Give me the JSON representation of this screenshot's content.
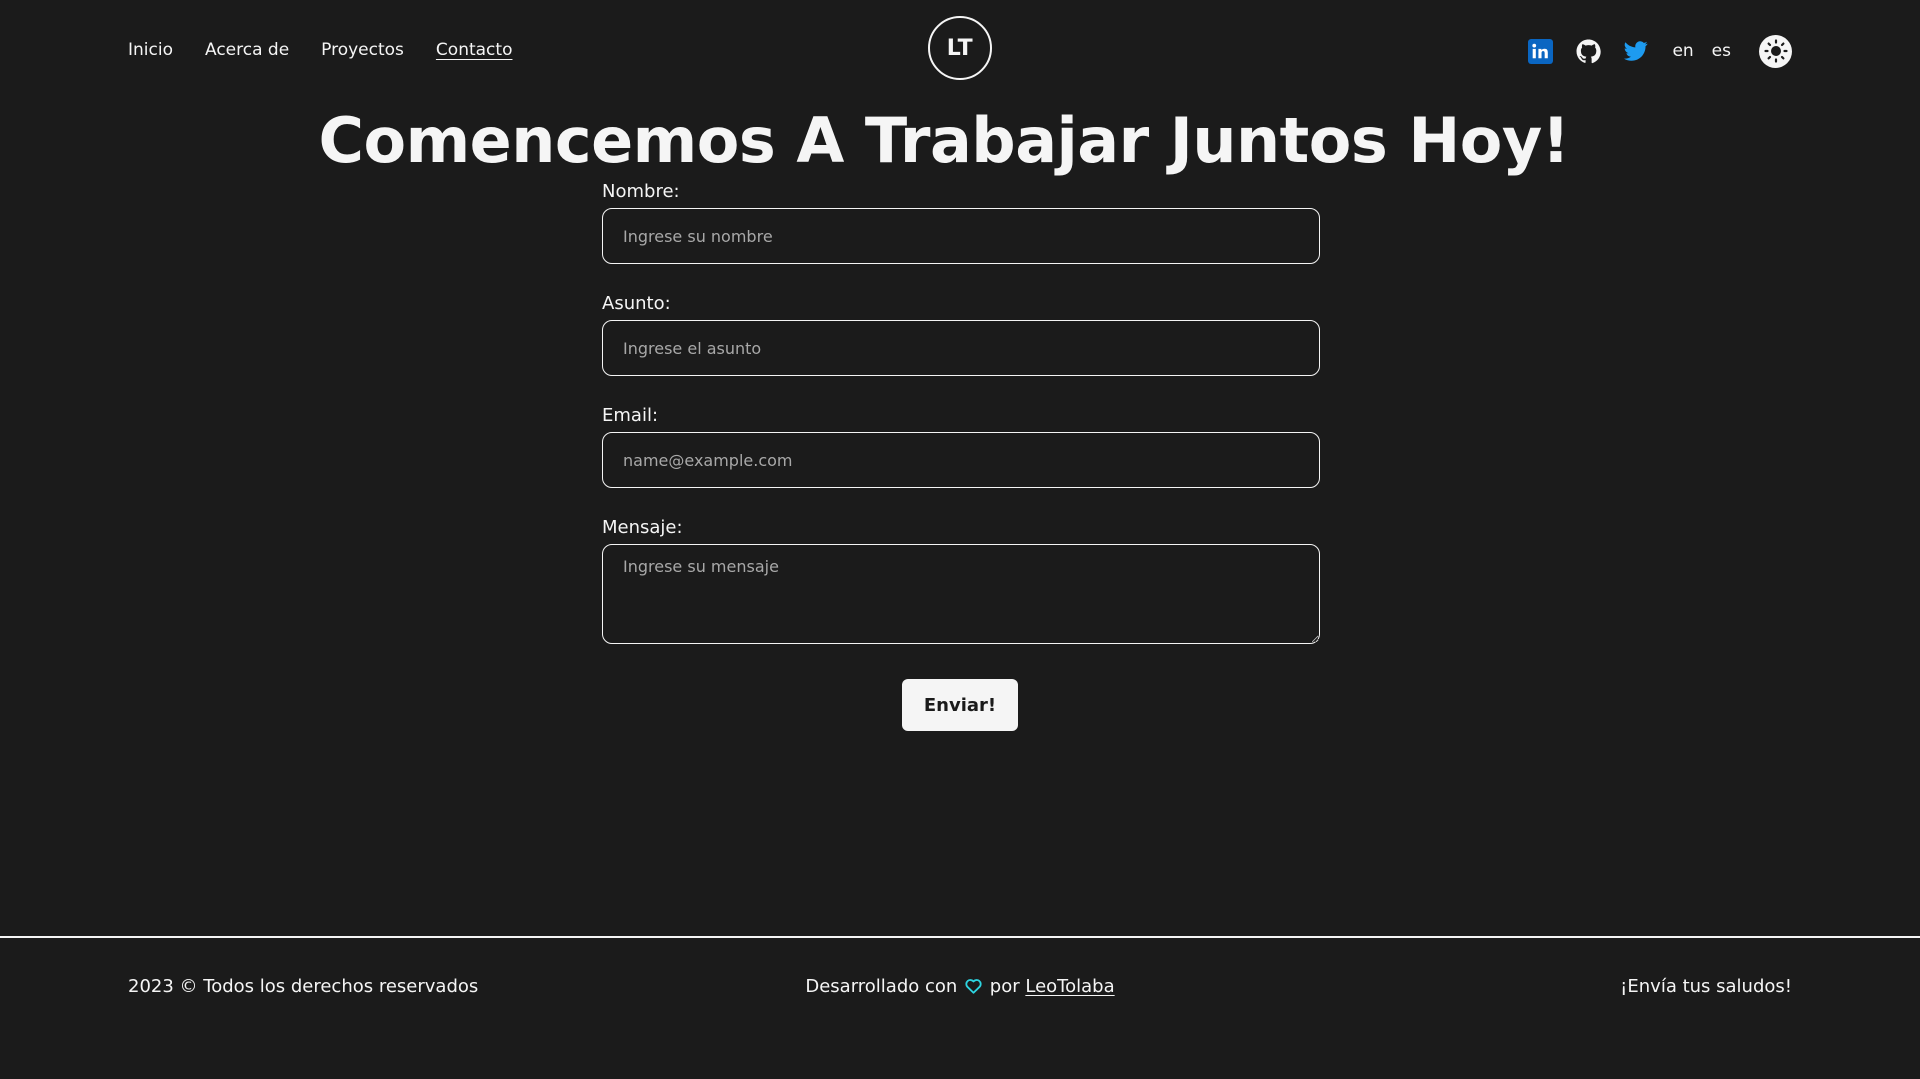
{
  "nav": {
    "items": [
      {
        "label": "Inicio"
      },
      {
        "label": "Acerca de"
      },
      {
        "label": "Proyectos"
      },
      {
        "label": "Contacto",
        "active": true
      }
    ]
  },
  "logo": {
    "text": "LT"
  },
  "social": {
    "icons": [
      "linkedin-icon",
      "github-icon",
      "twitter-icon"
    ],
    "linkedin_color": "#0a66c2",
    "twitter_color": "#1d9bf0"
  },
  "languages": [
    "en",
    "es"
  ],
  "theme_toggle": {
    "icon": "sun-icon"
  },
  "main": {
    "title": "Comencemos A Trabajar Juntos Hoy!",
    "form": {
      "name": {
        "label": "Nombre:",
        "placeholder": "Ingrese su nombre"
      },
      "subject": {
        "label": "Asunto:",
        "placeholder": "Ingrese el asunto"
      },
      "email": {
        "label": "Email:",
        "placeholder": "name@example.com"
      },
      "message": {
        "label": "Mensaje:",
        "placeholder": "Ingrese su mensaje"
      },
      "submit_label": "Enviar!"
    }
  },
  "footer": {
    "copyright": "2023 © Todos los derechos reservados",
    "credit_prefix": "Desarrollado con",
    "credit_by": "por",
    "author": "LeoTolaba",
    "greeting": "¡Envía tus saludos!",
    "heart_color": "#2dd4e0"
  },
  "colors": {
    "background": "#1b1b1b",
    "foreground": "#f5f5f5"
  }
}
